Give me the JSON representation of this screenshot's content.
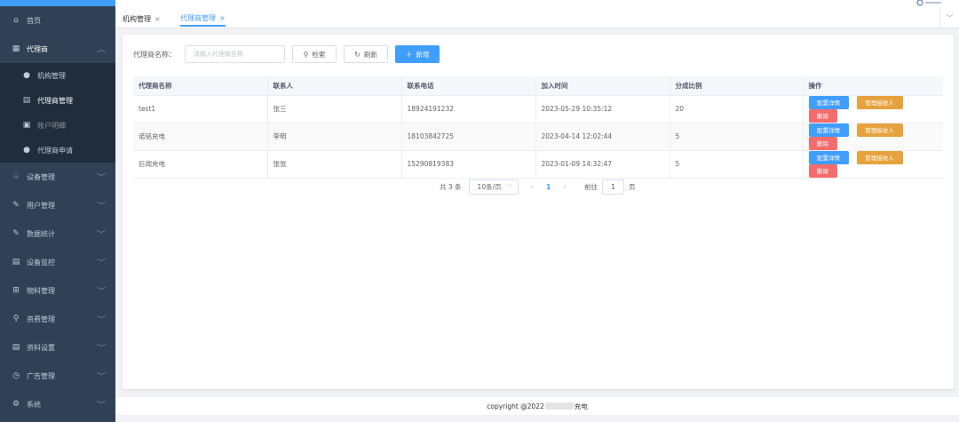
{
  "sidebar": {
    "items": [
      {
        "label": "首页",
        "icon": "home-icon"
      },
      {
        "label": "代理商",
        "icon": "grid-icon"
      },
      {
        "label": "设备管理",
        "icon": "bell-icon"
      },
      {
        "label": "用户管理",
        "icon": "edit-icon"
      },
      {
        "label": "数据统计",
        "icon": "edit-icon"
      },
      {
        "label": "设备监控",
        "icon": "document-icon"
      },
      {
        "label": "物料管理",
        "icon": "grid-icon"
      },
      {
        "label": "资费管理",
        "icon": "search-icon"
      },
      {
        "label": "资料设置",
        "icon": "document-icon"
      },
      {
        "label": "广告管理",
        "icon": "clock-icon"
      },
      {
        "label": "系统",
        "icon": "gear-icon"
      }
    ],
    "submenu": [
      {
        "label": "机构管理",
        "icon": "user-icon"
      },
      {
        "label": "代理商管理",
        "icon": "grid-icon"
      },
      {
        "label": "账户明细",
        "icon": "document-icon"
      },
      {
        "label": "代理商申请",
        "icon": "user-icon"
      }
    ]
  },
  "tabs": [
    {
      "label": "机构管理",
      "close": "×"
    },
    {
      "label": "代理商管理",
      "close": "×"
    }
  ],
  "search": {
    "label": "代理商名称：",
    "placeholder": "请输入代理商名称",
    "search_label": "检索",
    "refresh_label": "刷新",
    "add_label": "新增"
  },
  "table": {
    "columns": [
      "代理商名称",
      "联系人",
      "联系电话",
      "加入时间",
      "分成比例",
      "操作"
    ],
    "rows": [
      [
        "test1",
        "张三",
        "18924191232",
        "2023-05-29 10:35:12",
        "20"
      ],
      [
        "诺铭充电",
        "李明",
        "18103842725",
        "2023-04-14 12:02:44",
        "5"
      ],
      [
        "巨闻充电",
        "张张",
        "15290819383",
        "2023-01-09 14:32:47",
        "5"
      ]
    ],
    "actions": {
      "detail": "配置详情",
      "receiver": "管理接收人",
      "delete": "删除"
    }
  },
  "pagination": {
    "total": "共 3 条",
    "page_size": "10条/页",
    "current_page": "1",
    "goto_label": "前往",
    "goto_value": "1",
    "page_suffix": "页"
  },
  "footer": {
    "prefix": "copyright @2022",
    "suffix": "充电"
  },
  "colors": {
    "primary": "#409eff",
    "warning": "#e6a23c",
    "danger": "#f56c6c",
    "sidebar_bg": "#304156"
  }
}
